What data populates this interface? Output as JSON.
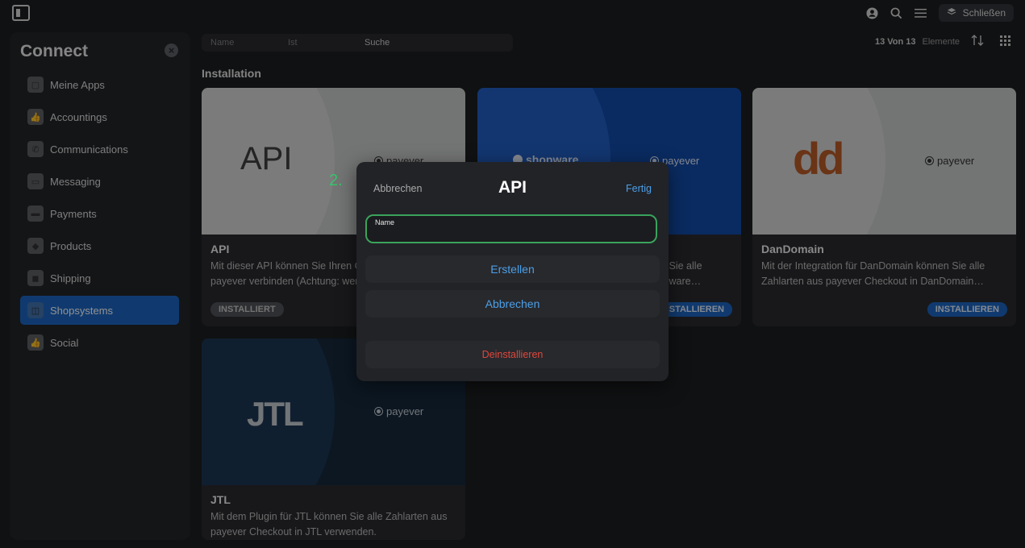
{
  "topbar": {
    "close_label": "Schließen"
  },
  "sidebar": {
    "title": "Connect",
    "items": [
      {
        "label": "Meine Apps",
        "icon": "apps-icon"
      },
      {
        "label": "Accountings",
        "icon": "thumbs-up-icon"
      },
      {
        "label": "Communications",
        "icon": "phone-icon"
      },
      {
        "label": "Messaging",
        "icon": "message-icon"
      },
      {
        "label": "Payments",
        "icon": "credit-card-icon"
      },
      {
        "label": "Products",
        "icon": "tag-icon"
      },
      {
        "label": "Shipping",
        "icon": "box-icon"
      },
      {
        "label": "Shopsystems",
        "icon": "shopping-bag-icon",
        "active": true
      },
      {
        "label": "Social",
        "icon": "thumbs-up-icon"
      }
    ]
  },
  "search": {
    "col1": "Name",
    "col2": "Ist",
    "col3": "Suche"
  },
  "results": {
    "count": "13 Von 13",
    "unit": "Elemente"
  },
  "section_title": "Installation",
  "cards": [
    {
      "name": "API",
      "logo": "API",
      "desc": "Mit dieser API können Sie Ihren Online-Shop mit payever verbinden (Achtung: wenden Sie sich an …",
      "button": "INSTALLIERT",
      "brand": "payever"
    },
    {
      "name": "Shopware",
      "logo": "shopware",
      "desc": "Mit der Integration für Shopware können Sie alle Zahlarten aus payever Checkout in Shopware…",
      "button": "INSTALLIEREN",
      "brand": "payever"
    },
    {
      "name": "DanDomain",
      "logo": "dd",
      "desc": "Mit der Integration für DanDomain können Sie alle Zahlarten aus payever Checkout in DanDomain…",
      "button": "INSTALLIEREN",
      "brand": "payever"
    },
    {
      "name": "JTL",
      "logo": "JTL",
      "desc": "Mit dem Plugin für JTL können Sie alle Zahlarten aus payever Checkout in JTL verwenden.",
      "button": "",
      "brand": "payever"
    }
  ],
  "modal": {
    "cancel": "Abbrechen",
    "title": "API",
    "done": "Fertig",
    "field_label": "Name",
    "field_value": "",
    "create": "Erstellen",
    "abort": "Abbrechen",
    "uninstall": "Deinstallieren"
  },
  "step_label": "2.",
  "colors": {
    "accent": "#1461c2",
    "link": "#4c9fe8",
    "danger": "#e0473c",
    "focus": "#3aa35b"
  }
}
